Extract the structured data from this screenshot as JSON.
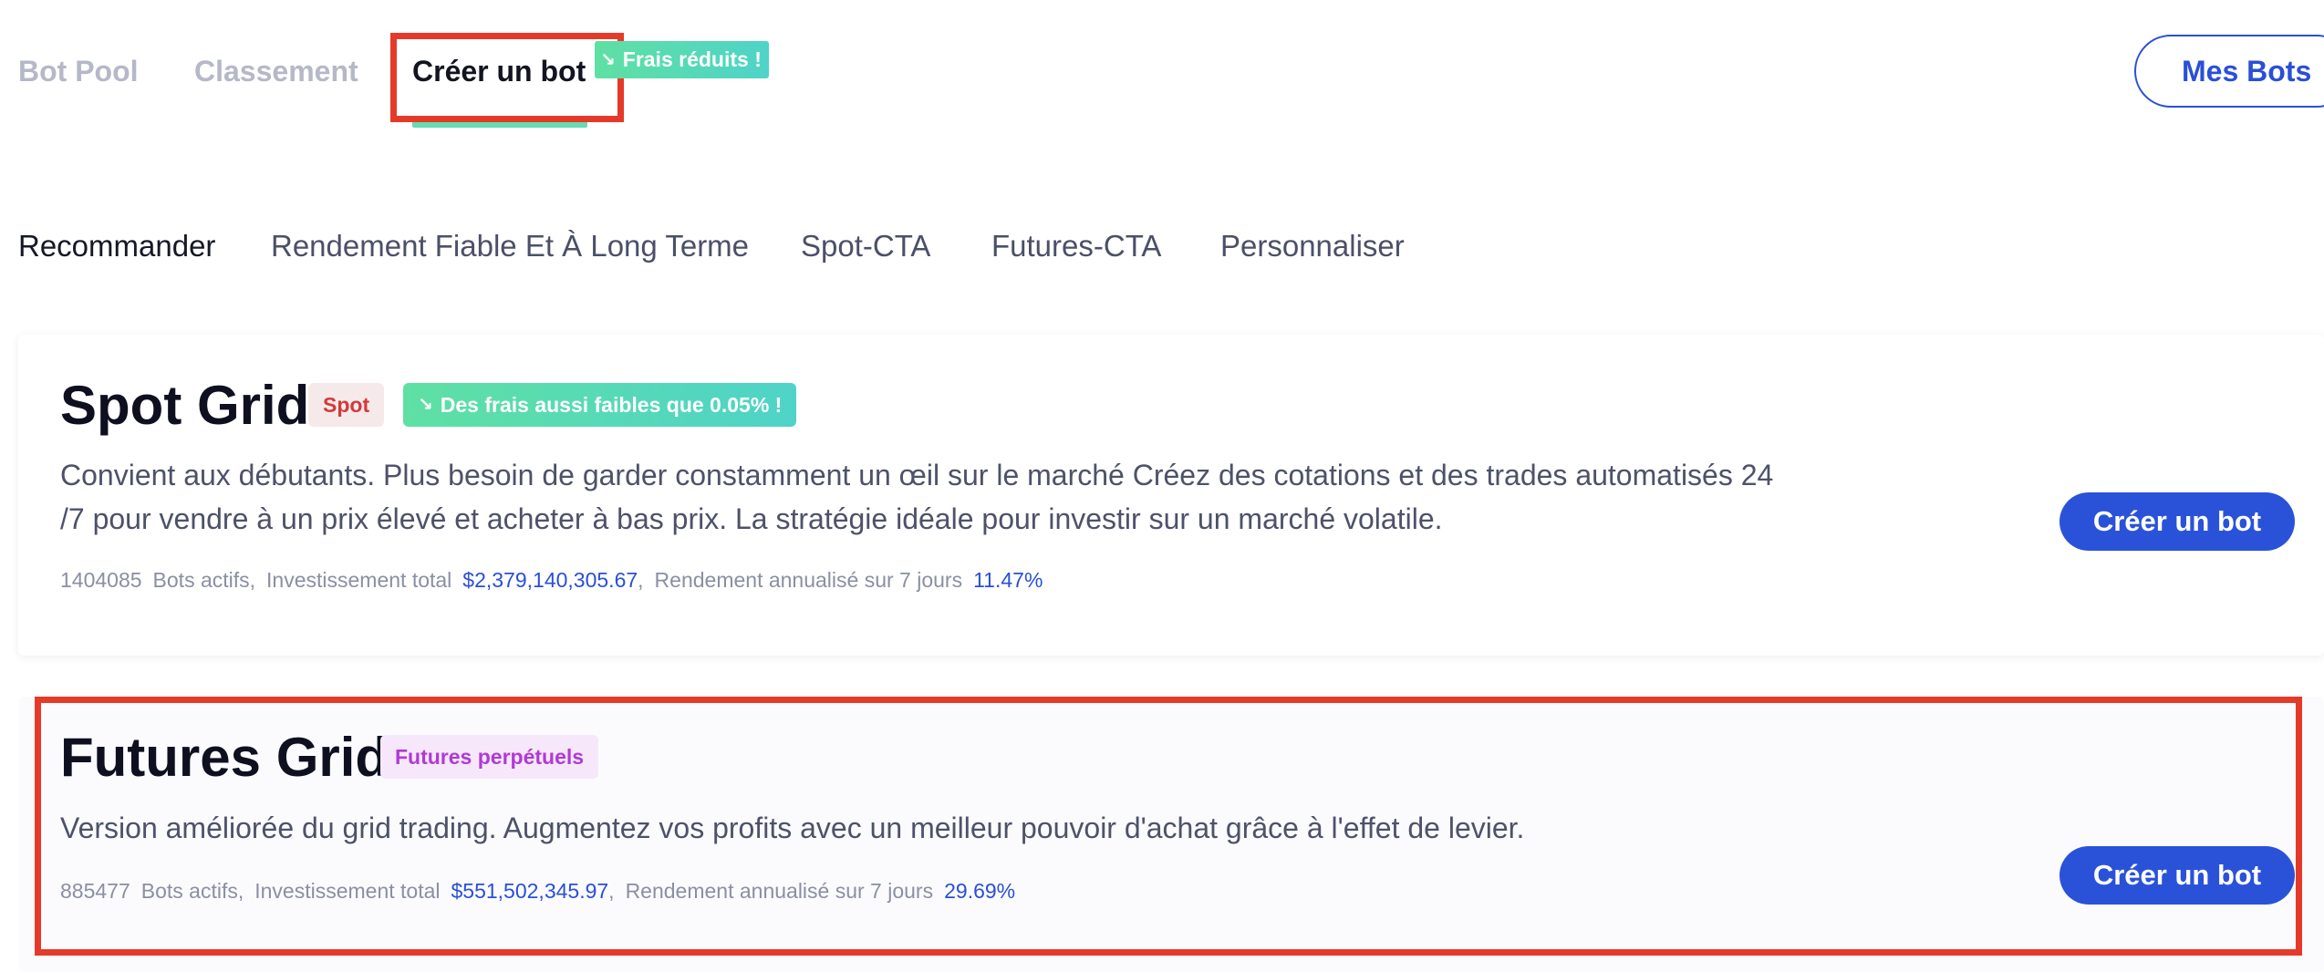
{
  "topnav": {
    "tabs": [
      {
        "label": "Bot Pool"
      },
      {
        "label": "Classement"
      },
      {
        "label": "Créer un bot"
      }
    ],
    "promo_badge": "Frais réduits !",
    "my_bots_button": "Mes Bots"
  },
  "categories": [
    {
      "label": "Recommander"
    },
    {
      "label": "Rendement Fiable Et À Long Terme"
    },
    {
      "label": "Spot-CTA"
    },
    {
      "label": "Futures-CTA"
    },
    {
      "label": "Personnaliser"
    }
  ],
  "cards": [
    {
      "title": "Spot Grid",
      "tag": "Spot",
      "fee_badge": "Des frais aussi faibles que 0.05% !",
      "description_line1": "Convient aux débutants. Plus besoin de garder constamment un œil sur le marché Créez des cotations et des trades automatisés 24",
      "description_line2": "/7 pour vendre à un prix élevé et acheter à bas prix. La stratégie idéale pour investir sur un marché volatile.",
      "active_bots": "1404085",
      "active_bots_label": "Bots actifs,",
      "investment_label": "Investissement total",
      "investment_value": "$2,379,140,305.67",
      "investment_sep": ",",
      "yield_label": "Rendement annualisé sur 7 jours",
      "yield_value": "11.47%",
      "button": "Créer un bot"
    },
    {
      "title": "Futures Grid",
      "tag": "Futures perpétuels",
      "description_line1": "Version améliorée du grid trading. Augmentez vos profits avec un meilleur pouvoir d'achat grâce à l'effet de levier.",
      "active_bots": "885477",
      "active_bots_label": "Bots actifs,",
      "investment_label": "Investissement total",
      "investment_value": "$551,502,345.97",
      "investment_sep": ",",
      "yield_label": "Rendement annualisé sur 7 jours",
      "yield_value": "29.69%",
      "button": "Créer un bot"
    }
  ],
  "icons": {
    "fee_trend": "trend-down-icon"
  },
  "colors": {
    "accent": "#2a52d9",
    "highlight": "#e53a2a",
    "promo": "#5fe0a3"
  }
}
